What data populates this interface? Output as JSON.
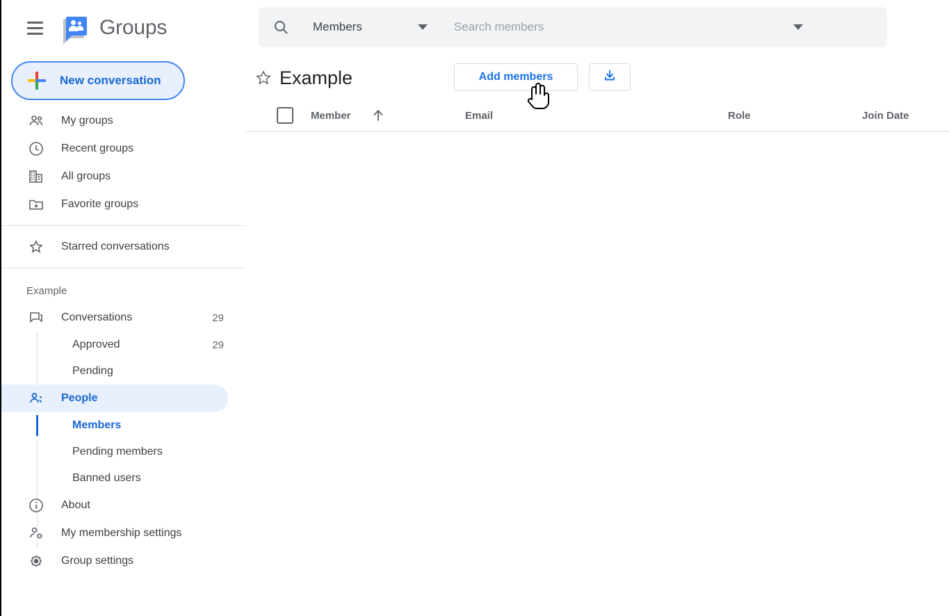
{
  "app": {
    "brand_title": "Groups",
    "menu_icon": "hamburger-menu-icon",
    "logo_icon": "google-groups-logo-icon"
  },
  "sidebar": {
    "new_conversation_label": "New conversation",
    "nav_items": [
      {
        "label": "My groups",
        "icon": "people-icon"
      },
      {
        "label": "Recent groups",
        "icon": "clock-icon"
      },
      {
        "label": "All groups",
        "icon": "building-icon"
      },
      {
        "label": "Favorite groups",
        "icon": "folder-star-icon"
      }
    ],
    "starred_label": "Starred conversations",
    "starred_icon": "star-outline-icon",
    "group_name": "Example",
    "group_items": [
      {
        "label": "Conversations",
        "count": "29",
        "icon": "conversations-icon",
        "active": false
      },
      {
        "label": "Approved",
        "count": "29",
        "sub": true,
        "active": false
      },
      {
        "label": "Pending",
        "count": "",
        "sub": true,
        "active": false
      },
      {
        "label": "People",
        "count": "",
        "icon": "people-icon",
        "active": true
      },
      {
        "label": "Members",
        "count": "",
        "sub": true,
        "active": true
      },
      {
        "label": "Pending members",
        "count": "",
        "sub": true,
        "active": false
      },
      {
        "label": "Banned users",
        "count": "",
        "sub": true,
        "active": false
      },
      {
        "label": "About",
        "count": "",
        "icon": "info-icon",
        "active": false
      },
      {
        "label": "My membership settings",
        "count": "",
        "icon": "person-gear-icon",
        "active": false
      },
      {
        "label": "Group settings",
        "count": "",
        "icon": "gear-icon",
        "active": false
      }
    ]
  },
  "search": {
    "scope_label": "Members",
    "placeholder": "Search members",
    "value": "",
    "search_icon": "search-icon",
    "scope_caret_icon": "chevron-down-icon",
    "right_caret_icon": "chevron-down-icon"
  },
  "content": {
    "page_title": "Example",
    "star_icon": "star-outline-icon",
    "add_members_label": "Add members",
    "download_icon": "download-icon",
    "table": {
      "headers": [
        "Member",
        "Email",
        "Role",
        "Join Date"
      ],
      "sort_icon": "arrow-up-icon",
      "select_all_checkbox": "unchecked",
      "rows": []
    }
  },
  "colors": {
    "accent_blue": "#1a73e8",
    "active_pill": "#e8f0fe",
    "text_primary": "#3c4043",
    "text_secondary": "#5f6368"
  }
}
